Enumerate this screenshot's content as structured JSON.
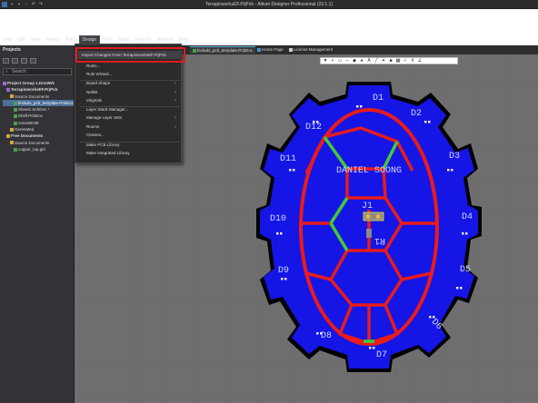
{
  "window": {
    "title": "TerrapinworksEF.PrjPcb - Altium Designer Professional (23.1.1)"
  },
  "menubar": {
    "items": [
      "File",
      "Edit",
      "View",
      "Project",
      "Place",
      "Design",
      "Tools",
      "Route",
      "Reports",
      "Window",
      "Help"
    ],
    "active": "Design"
  },
  "left_panel": {
    "title": "Projects",
    "search_placeholder": "Search",
    "tree": [
      {
        "label": "Project Group 1.DsnWrk",
        "level": 0,
        "type": "group",
        "bold": true
      },
      {
        "label": "TerrapinworksEF.PrjPcb",
        "level": 1,
        "type": "proj",
        "bold": true
      },
      {
        "label": "Source Documents",
        "level": 2,
        "type": "folder"
      },
      {
        "label": "fecludo_pcb_template.PcbDoc",
        "level": 3,
        "type": "doc",
        "selected": true
      },
      {
        "label": "Sheet1.SchDoc *",
        "level": 3,
        "type": "doc"
      },
      {
        "label": "Shell.PcbDoc",
        "level": 3,
        "type": "doc"
      },
      {
        "label": "ActiveBOM",
        "level": 3,
        "type": "doc"
      },
      {
        "label": "Generated",
        "level": 2,
        "type": "folder"
      },
      {
        "label": "Free Documents",
        "level": 1,
        "type": "folder",
        "bold": true
      },
      {
        "label": "Source Documents",
        "level": 2,
        "type": "folder"
      },
      {
        "label": "copper_top.gbr",
        "level": 3,
        "type": "doc"
      }
    ]
  },
  "doc_tabs": [
    {
      "label": "fecludo_pcb_template.PcbDoc",
      "active": true
    },
    {
      "label": "Home Page",
      "active": false
    },
    {
      "label": "License Management",
      "active": false
    }
  ],
  "design_menu": {
    "highlighted": "Import Changes From TerrapinworksEF.PrjPcb",
    "items": [
      {
        "label": "Import Changes From TerrapinworksEF.PrjPcb",
        "arrow": false
      },
      {
        "label": "Rules...",
        "arrow": false
      },
      {
        "label": "Rule Wizard...",
        "arrow": false
      },
      {
        "label": "Board Shape",
        "arrow": true
      },
      {
        "label": "Netlist",
        "arrow": true
      },
      {
        "label": "xSignals",
        "arrow": true
      },
      {
        "label": "Layer Stack Manager...",
        "arrow": false
      },
      {
        "label": "Manage Layer Sets",
        "arrow": true
      },
      {
        "label": "Rooms",
        "arrow": true
      },
      {
        "label": "Classes...",
        "arrow": false
      },
      {
        "label": "Make PCB Library",
        "arrow": false
      },
      {
        "label": "Make Integrated Library",
        "arrow": false
      }
    ]
  },
  "pcb_toolbar_icons": [
    "filter-icon",
    "plus-icon",
    "rect-select-icon",
    "route-icon",
    "place-icon",
    "via-icon",
    "text-icon",
    "line-icon",
    "bulb-icon",
    "pad-icon",
    "fill-icon",
    "check-icon",
    "grid-icon",
    "angle-icon"
  ],
  "board": {
    "silkscreen_text": "DANIEL SOONG",
    "designators": [
      "D1",
      "D2",
      "D3",
      "D4",
      "D5",
      "D6",
      "D7",
      "D8",
      "D9",
      "D10",
      "D11",
      "D12",
      "J1",
      "R1"
    ],
    "colors": {
      "copper": "#1515e6",
      "trace": "#e81c1c",
      "silk": "#f2e23a",
      "outline": "#000000",
      "green_trace": "#3ccc3c",
      "text": "#cfd6ff"
    }
  }
}
